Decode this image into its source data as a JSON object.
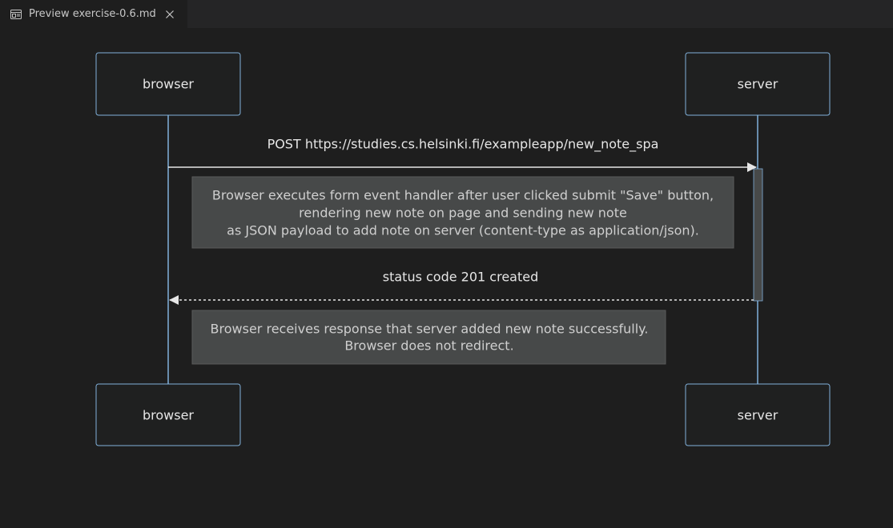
{
  "tab": {
    "label": "Preview exercise-0.6.md",
    "icon": "preview-icon",
    "close_icon": "close-icon"
  },
  "colors": {
    "background": "#1e1e1e",
    "tabbar": "#252526",
    "actor_border": "#81b1db",
    "actor_fill": "#1f2020",
    "note_fill": "#474949",
    "activation_fill": "#474949",
    "text": "#e6e6e6"
  },
  "diagram": {
    "participants": {
      "browser": "browser",
      "server": "server"
    },
    "messages": {
      "post": "POST https://studies.cs.helsinki.fi/exampleapp/new_note_spa",
      "response": "status code 201 created"
    },
    "notes": {
      "note1": {
        "line1": "Browser executes form event handler after user clicked submit \"Save\" button,",
        "line2": "rendering new note on page and sending new note",
        "line3": "as JSON payload to add note on server (content-type as application/json)."
      },
      "note2": {
        "line1": "Browser receives response that server added new note successfully.",
        "line2": "Browser does not redirect."
      }
    }
  }
}
